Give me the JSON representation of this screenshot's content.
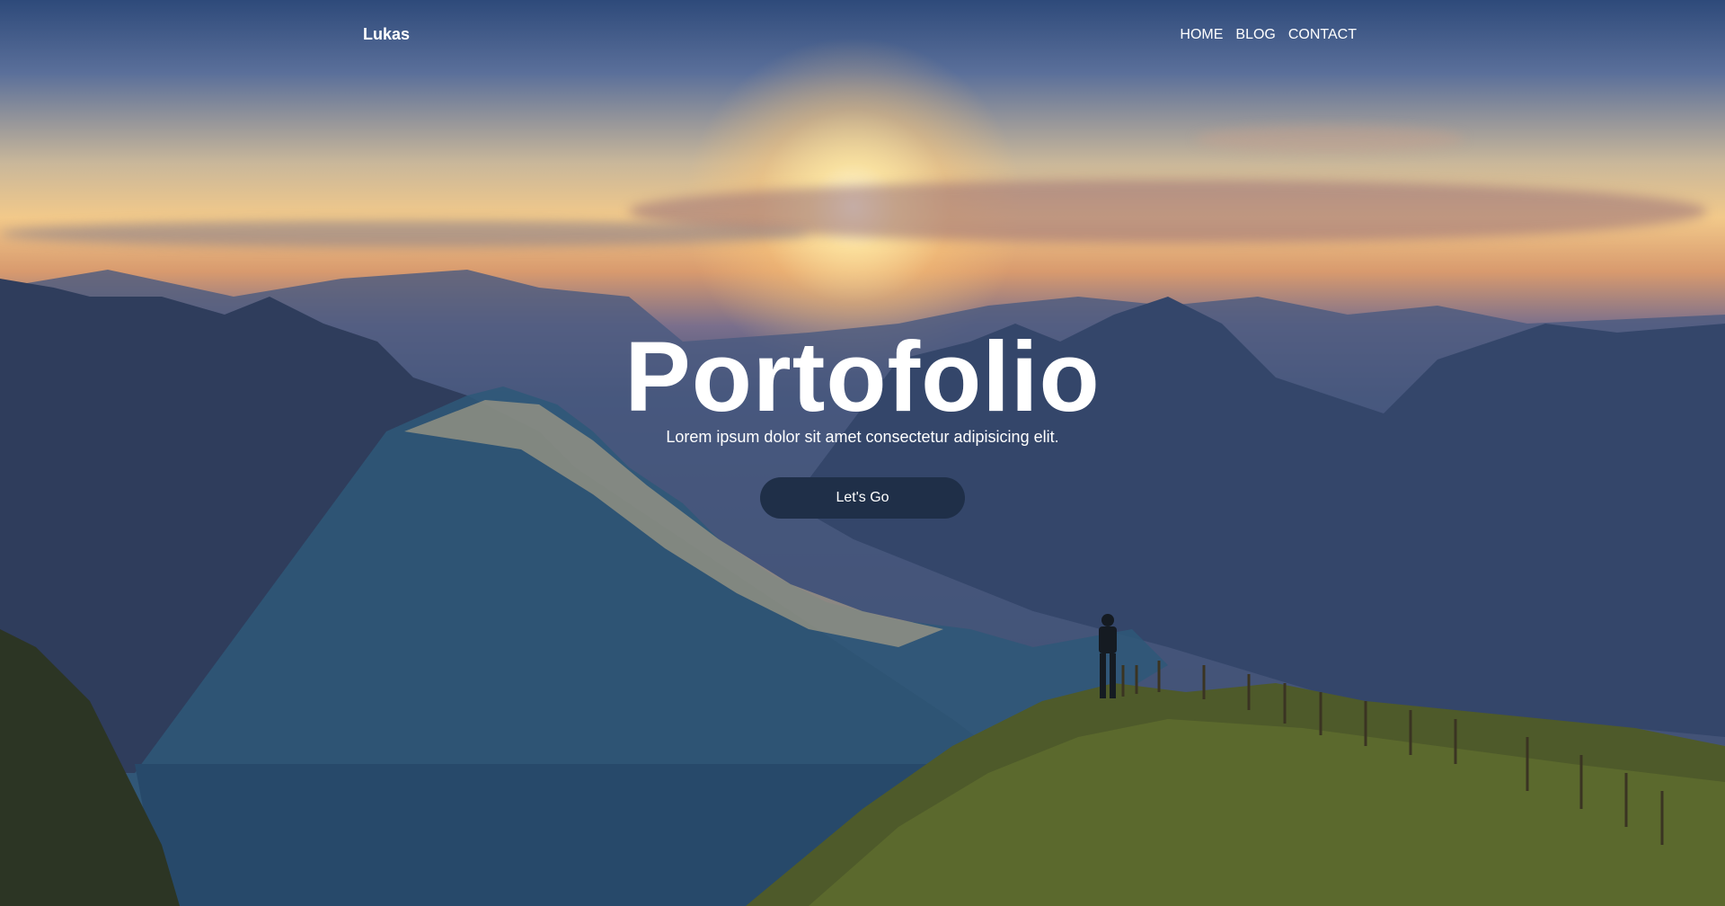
{
  "header": {
    "brand": "Lukas",
    "nav": [
      {
        "label": "HOME"
      },
      {
        "label": "BLOG"
      },
      {
        "label": "CONTACT"
      }
    ]
  },
  "hero": {
    "title": "Portofolio",
    "subtitle": "Lorem ipsum dolor sit amet consectetur adipisicing elit.",
    "cta_label": "Let's Go"
  },
  "colors": {
    "cta_background": "#1f2f48",
    "text": "#ffffff"
  }
}
